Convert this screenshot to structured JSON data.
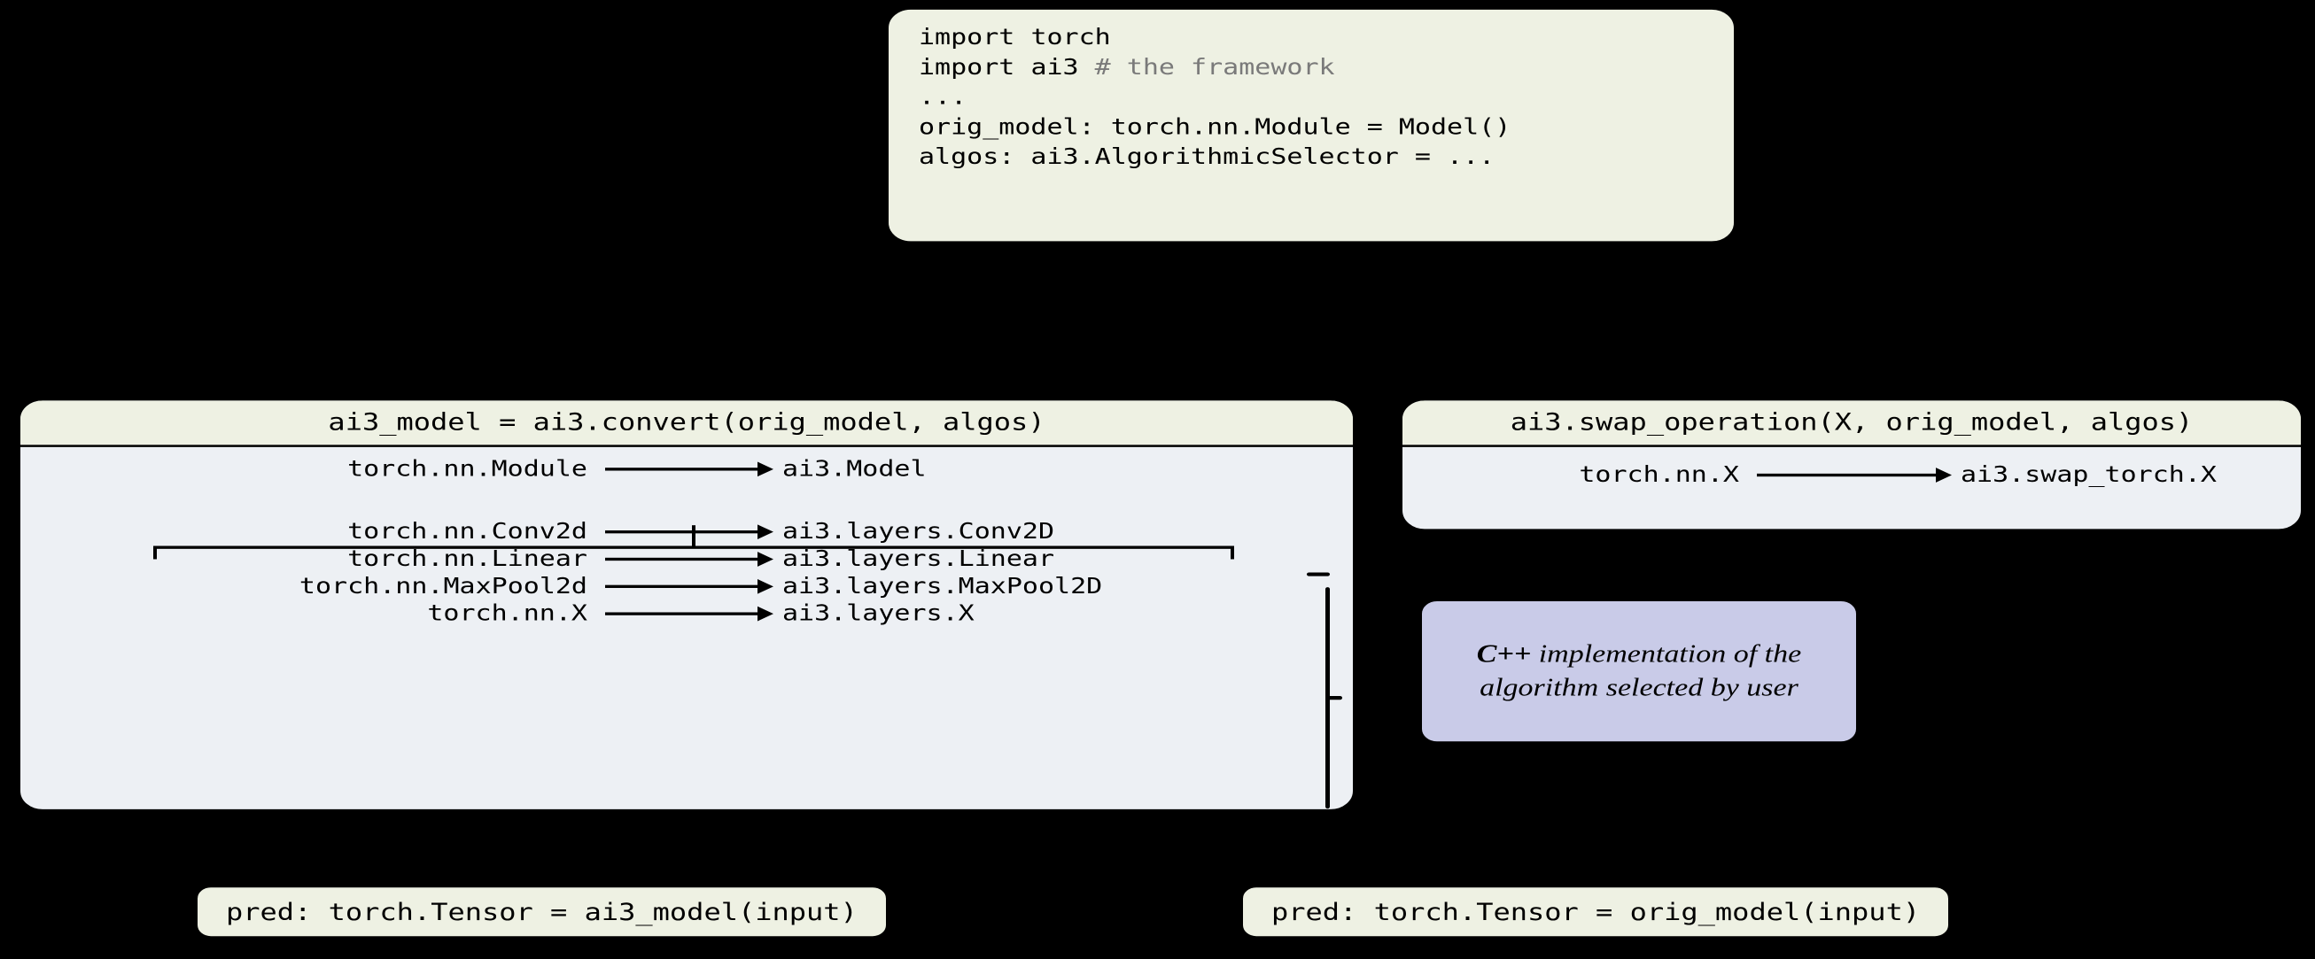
{
  "top_code": {
    "line1_pre": "import ",
    "line1_mod": "torch",
    "line2_pre": "import ",
    "line2_mod": "ai3",
    "line2_comment": " # the framework",
    "line3": "...",
    "line4": "",
    "line5": "orig_model: torch.nn.Module = Model()",
    "line6": "algos: ai3.AlgorithmicSelector = ..."
  },
  "left_panel": {
    "header": "ai3_model = ai3.convert(orig_model, algos)",
    "module_row": {
      "left": "torch.nn.Module",
      "right": "ai3.Model"
    },
    "rows": [
      {
        "left": "torch.nn.Conv2d",
        "right": "ai3.layers.Conv2D"
      },
      {
        "left": "torch.nn.Linear",
        "right": "ai3.layers.Linear"
      },
      {
        "left": "torch.nn.MaxPool2d",
        "right": "ai3.layers.MaxPool2D"
      },
      {
        "left": "torch.nn.X",
        "right": "ai3.layers.X"
      }
    ]
  },
  "right_panel": {
    "header": "ai3.swap_operation(X, orig_model, algos)",
    "row": {
      "left": "torch.nn.X",
      "right": "ai3.swap_torch.X"
    }
  },
  "cpp_note": {
    "prefix": "C++",
    "rest": " implementation of the algorithm selected by user"
  },
  "results": {
    "left": "pred: torch.Tensor = ai3_model(input)",
    "right": "pred: torch.Tensor = orig_model(input)"
  }
}
